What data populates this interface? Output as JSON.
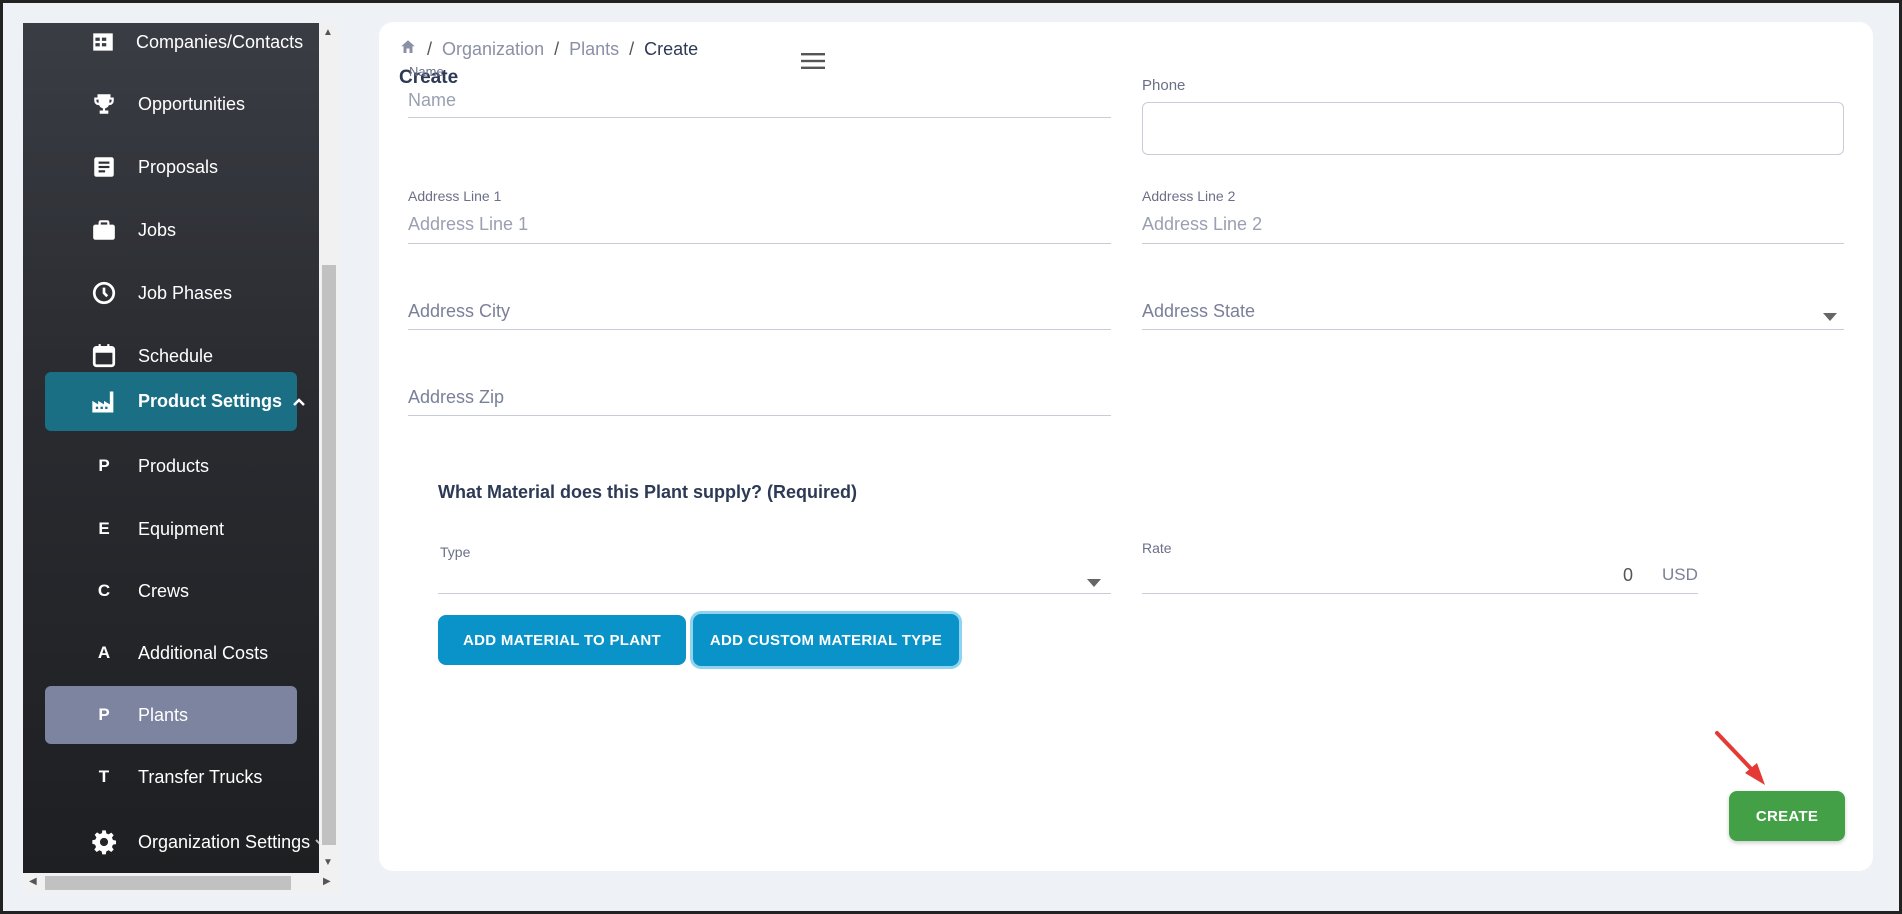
{
  "sidebar": {
    "items": [
      {
        "label": "Companies/Contacts",
        "icon": "building-icon"
      },
      {
        "label": "Opportunities",
        "icon": "trophy-icon"
      },
      {
        "label": "Proposals",
        "icon": "document-icon"
      },
      {
        "label": "Jobs",
        "icon": "briefcase-icon"
      },
      {
        "label": "Job Phases",
        "icon": "clock-icon"
      },
      {
        "label": "Schedule",
        "icon": "calendar-icon"
      },
      {
        "label": "Product Settings",
        "icon": "factory-icon"
      },
      {
        "label": "Products",
        "letter": "P"
      },
      {
        "label": "Equipment",
        "letter": "E"
      },
      {
        "label": "Crews",
        "letter": "C"
      },
      {
        "label": "Additional Costs",
        "letter": "A"
      },
      {
        "label": "Plants",
        "letter": "P"
      },
      {
        "label": "Transfer Trucks",
        "letter": "T"
      },
      {
        "label": "Organization Settings",
        "icon": "gear-icon"
      }
    ],
    "active_color": "#1a6f85",
    "selected_color": "#7d84a0"
  },
  "breadcrumb": {
    "items": [
      "Organization",
      "Plants",
      "Create"
    ],
    "separator": "/"
  },
  "page_title": "Create",
  "form": {
    "name": {
      "label": "Name",
      "placeholder": "Name"
    },
    "phone": {
      "label": "Phone",
      "value": ""
    },
    "address_line_1": {
      "label": "Address Line 1",
      "placeholder": "Address Line 1"
    },
    "address_line_2": {
      "label": "Address Line 2",
      "placeholder": "Address Line 2"
    },
    "address_city": {
      "label": "Address City"
    },
    "address_state": {
      "label": "Address State"
    },
    "address_zip": {
      "label": "Address Zip"
    }
  },
  "material": {
    "heading": "What Material does this Plant supply? (Required)",
    "type_label": "Type",
    "rate_label": "Rate",
    "rate_value": "0",
    "rate_unit": "USD",
    "add_material_button": "ADD MATERIAL TO PLANT",
    "add_custom_button": "ADD CUSTOM MATERIAL TYPE"
  },
  "create_button": "CREATE",
  "colors": {
    "primary": "#0a93c8",
    "success": "#43a047",
    "annotation_arrow": "#e53935"
  }
}
